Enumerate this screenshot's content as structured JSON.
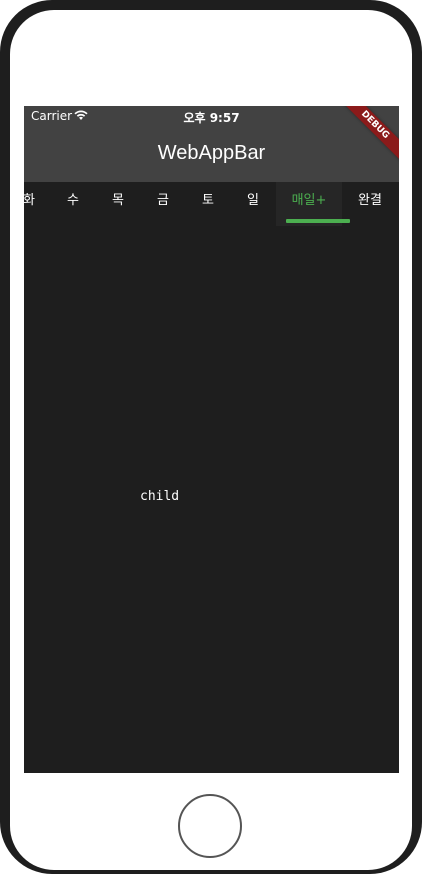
{
  "status_bar": {
    "carrier": "Carrier",
    "time": "오후 9:57",
    "wifi_icon": "wifi-icon"
  },
  "app_bar": {
    "title": "WebAppBar"
  },
  "tabs": [
    {
      "label": "화",
      "selected": false
    },
    {
      "label": "수",
      "selected": false
    },
    {
      "label": "목",
      "selected": false
    },
    {
      "label": "금",
      "selected": false
    },
    {
      "label": "토",
      "selected": false
    },
    {
      "label": "일",
      "selected": false
    },
    {
      "label": "매일+",
      "selected": true
    },
    {
      "label": "완결",
      "selected": false
    }
  ],
  "body": {
    "text": "child"
  },
  "debug_banner": {
    "label": "DEBUG"
  },
  "colors": {
    "background": "#1e1e1e",
    "app_bar": "#424242",
    "accent": "#4caf50",
    "debug": "#8b1a1a"
  }
}
